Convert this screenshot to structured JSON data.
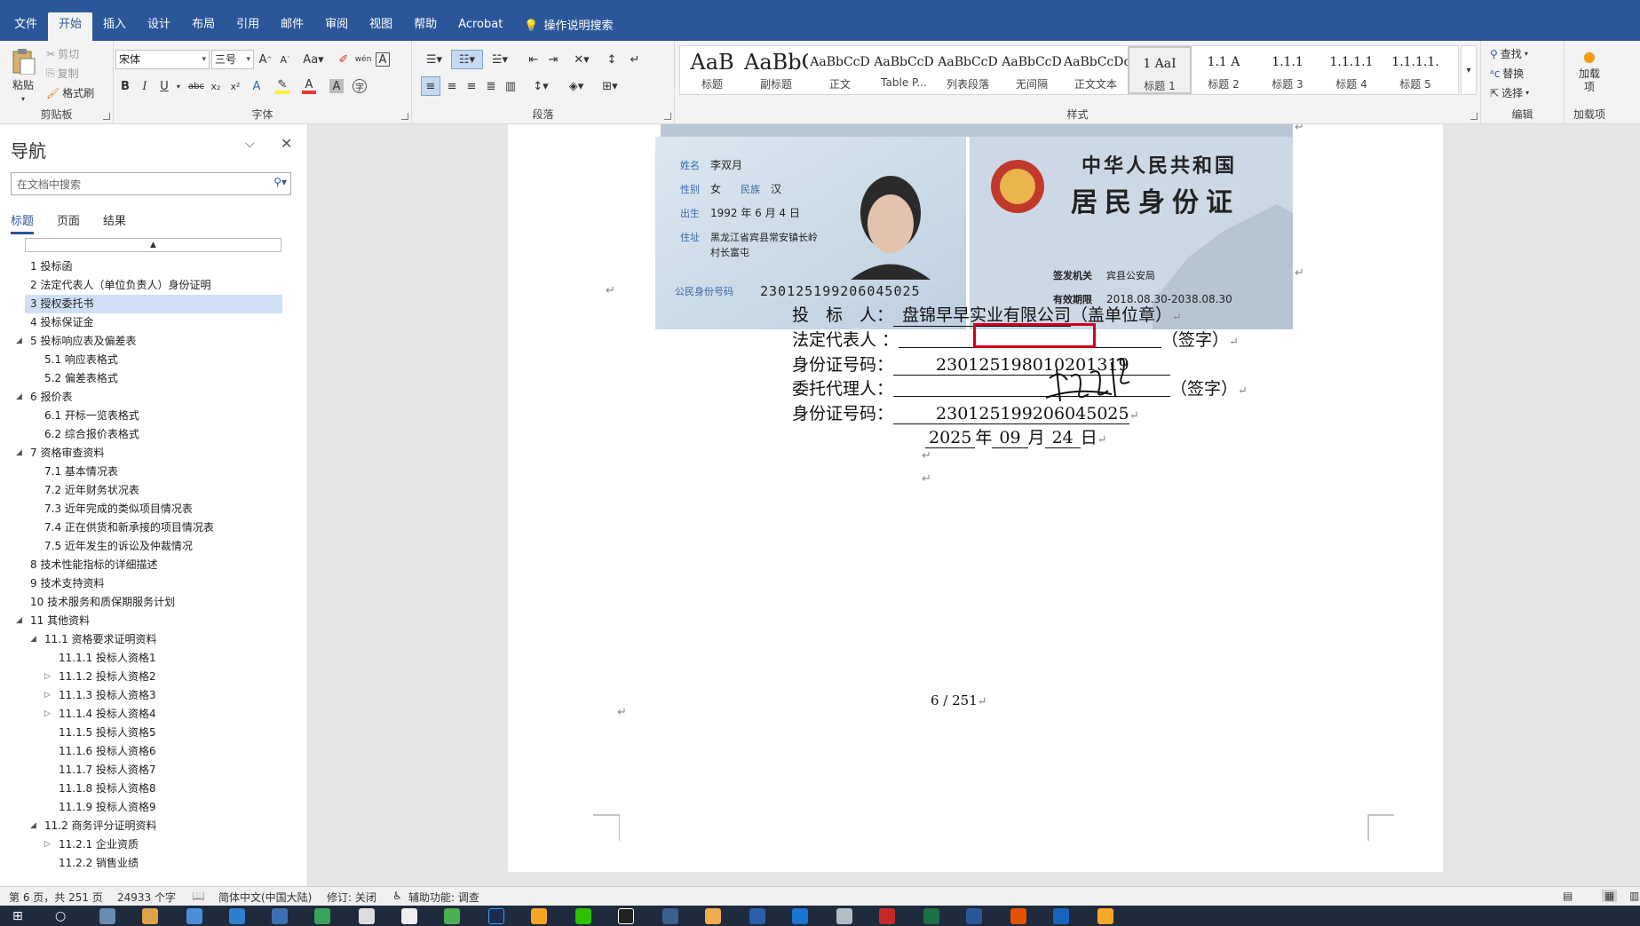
{
  "ribbon_tabs": [
    "文件",
    "开始",
    "插入",
    "设计",
    "布局",
    "引用",
    "邮件",
    "审阅",
    "视图",
    "帮助",
    "Acrobat"
  ],
  "tell_me": "操作说明搜索",
  "clipboard": {
    "paste": "粘贴",
    "cut": "剪切",
    "copy": "复制",
    "painter": "格式刷",
    "label": "剪贴板"
  },
  "font": {
    "name": "宋体",
    "size": "三号",
    "label": "字体"
  },
  "paragraph": {
    "label": "段落"
  },
  "styles": {
    "label": "样式",
    "items": [
      {
        "preview": "AaB",
        "name": "标题"
      },
      {
        "preview": "AaBbC",
        "name": "副标题"
      },
      {
        "preview": "AaBbCcD",
        "name": "正文"
      },
      {
        "preview": "AaBbCcD",
        "name": "Table P..."
      },
      {
        "preview": "AaBbCcD",
        "name": "列表段落"
      },
      {
        "preview": "AaBbCcD",
        "name": "无间隔"
      },
      {
        "preview": "AaBbCcDd",
        "name": "正文文本"
      },
      {
        "preview": "1 AaI",
        "name": "标题 1"
      },
      {
        "preview": "1.1 A",
        "name": "标题 2"
      },
      {
        "preview": "1.1.1",
        "name": "标题 3"
      },
      {
        "preview": "1.1.1.1",
        "name": "标题 4"
      },
      {
        "preview": "1.1.1.1.",
        "name": "标题 5"
      }
    ]
  },
  "editing": {
    "find": "查找",
    "replace": "替换",
    "select": "选择",
    "label": "编辑"
  },
  "addins": {
    "button": "加载项",
    "label": "加载项"
  },
  "nav": {
    "title": "导航",
    "search_placeholder": "在文档中搜索",
    "tabs": [
      "标题",
      "页面",
      "结果"
    ],
    "items": [
      {
        "text": "1 投标函",
        "level": 1
      },
      {
        "text": "2 法定代表人（单位负责人）身份证明",
        "level": 1
      },
      {
        "text": "3 授权委托书",
        "level": 1,
        "selected": true
      },
      {
        "text": "4 投标保证金",
        "level": 1
      },
      {
        "text": "5 投标响应表及偏差表",
        "level": 1,
        "expand": "open"
      },
      {
        "text": "5.1 响应表格式",
        "level": 2
      },
      {
        "text": "5.2 偏差表格式",
        "level": 2
      },
      {
        "text": "6 报价表",
        "level": 1,
        "expand": "open"
      },
      {
        "text": "6.1 开标一览表格式",
        "level": 2
      },
      {
        "text": "6.2 综合报价表格式",
        "level": 2
      },
      {
        "text": "7 资格审查资料",
        "level": 1,
        "expand": "open"
      },
      {
        "text": "7.1 基本情况表",
        "level": 2
      },
      {
        "text": "7.2 近年财务状况表",
        "level": 2
      },
      {
        "text": "7.3 近年完成的类似项目情况表",
        "level": 2
      },
      {
        "text": "7.4 正在供货和新承接的项目情况表",
        "level": 2
      },
      {
        "text": "7.5 近年发生的诉讼及仲裁情况",
        "level": 2
      },
      {
        "text": "8 技术性能指标的详细描述",
        "level": 1
      },
      {
        "text": "9 技术支持资料",
        "level": 1
      },
      {
        "text": "10 技术服务和质保期服务计划",
        "level": 1
      },
      {
        "text": "11 其他资料",
        "level": 1,
        "expand": "open"
      },
      {
        "text": "11.1 资格要求证明资料",
        "level": 2,
        "expand": "open"
      },
      {
        "text": "11.1.1 投标人资格1",
        "level": 3
      },
      {
        "text": "11.1.2 投标人资格2",
        "level": 3,
        "expand": "closed"
      },
      {
        "text": "11.1.3 投标人资格3",
        "level": 3,
        "expand": "closed"
      },
      {
        "text": "11.1.4 投标人资格4",
        "level": 3,
        "expand": "closed"
      },
      {
        "text": "11.1.5 投标人资格5",
        "level": 3
      },
      {
        "text": "11.1.6 投标人资格6",
        "level": 3
      },
      {
        "text": "11.1.7 投标人资格7",
        "level": 3
      },
      {
        "text": "11.1.8 投标人资格8",
        "level": 3
      },
      {
        "text": "11.1.9 投标人资格9",
        "level": 3
      },
      {
        "text": "11.2 商务评分证明资料",
        "level": 2,
        "expand": "open"
      },
      {
        "text": "11.2.1 企业资质",
        "level": 3,
        "expand": "closed"
      },
      {
        "text": "11.2.2 销售业绩",
        "level": 3
      }
    ]
  },
  "idcard": {
    "front": {
      "name_label": "姓名",
      "name": "李双月",
      "sex_label": "性别",
      "sex": "女",
      "nation_label": "民族",
      "nation": "汉",
      "birth_label": "出生",
      "birth": "1992 年 6 月 4 日",
      "addr_label": "住址",
      "addr1": "黑龙江省宾县常安镇长岭",
      "addr2": "村长富屯",
      "idno_label": "公民身份号码",
      "idno": "230125199206045025"
    },
    "back": {
      "title1": "中华人民共和国",
      "title2": "居民身份证",
      "issuer_label": "签发机关",
      "issuer": "宾县公安局",
      "valid_label": "有效期限",
      "valid": "2018.08.30-2038.08.30"
    }
  },
  "form": {
    "bidder_label": "投　标　人：",
    "bidder_value": "盘锦早早实业有限公司",
    "bidder_suffix": "（盖单位章）",
    "legal_label": "法定代表人 ：",
    "sign_suffix": "（签字）",
    "id_label": "身份证号码：",
    "legal_id": "230125198010201319",
    "agent_label": "委托代理人：",
    "agent_suffix": "（签字）",
    "agent_id": "230125199206045025",
    "year": "2025",
    "year_unit": "年",
    "month": "09",
    "month_unit": "月",
    "day": "24",
    "day_unit": "日"
  },
  "page_number": "6 / 251",
  "status": {
    "page": "第 6 页，共 251 页",
    "words": "24933 个字",
    "lang": "简体中文(中国大陆)",
    "track": "修订: 关闭",
    "access": "辅助功能: 调查"
  }
}
